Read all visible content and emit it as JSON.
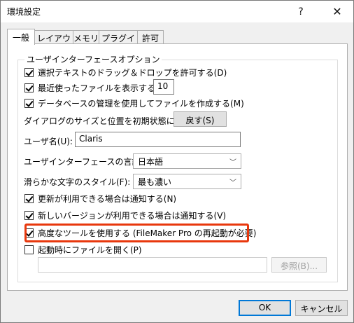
{
  "window": {
    "title": "環境設定",
    "help_glyph": "?",
    "close_glyph": "✕"
  },
  "tabs": [
    {
      "label": "一般",
      "active": true
    },
    {
      "label": "レイアウト",
      "active": false
    },
    {
      "label": "メモリ",
      "active": false
    },
    {
      "label": "プラグイン",
      "active": false
    },
    {
      "label": "許可",
      "active": false
    }
  ],
  "group": {
    "title": "ユーザインターフェースオプション"
  },
  "options": {
    "drag_drop": {
      "label": "選択テキストのドラッグ＆ドロップを許可する(D)",
      "checked": true
    },
    "recent_files": {
      "label": "最近使ったファイルを表示する(R):",
      "checked": true,
      "value": "10"
    },
    "manage_db": {
      "label": "データベースの管理を使用してファイルを作成する(M)",
      "checked": true
    },
    "reset_dialogs": {
      "label": "ダイアログのサイズと位置を初期状態に戻す:",
      "button": "戻す(S)"
    },
    "username": {
      "label": "ユーザ名(U):",
      "value": "Claris"
    },
    "ui_language": {
      "label": "ユーザインターフェースの言語(I):",
      "value": "日本語"
    },
    "smoothing": {
      "label": "滑らかな文字のスタイル(F):",
      "value": "最も濃い"
    },
    "notify_update": {
      "label": "更新が利用できる場合は通知する(N)",
      "checked": true
    },
    "notify_version": {
      "label": "新しいバージョンが利用できる場合は通知する(V)",
      "checked": true
    },
    "advanced_tools": {
      "label": "高度なツールを使用する (FileMaker Pro の再起動が必要)",
      "checked": true
    },
    "open_at_startup": {
      "label": "起動時にファイルを開く(P)",
      "checked": false,
      "path": "",
      "browse": "参照(B)..."
    }
  },
  "footer": {
    "ok": "OK",
    "cancel": "キャンセル"
  },
  "colors": {
    "highlight": "#e8380d",
    "focus": "#0078d7"
  }
}
